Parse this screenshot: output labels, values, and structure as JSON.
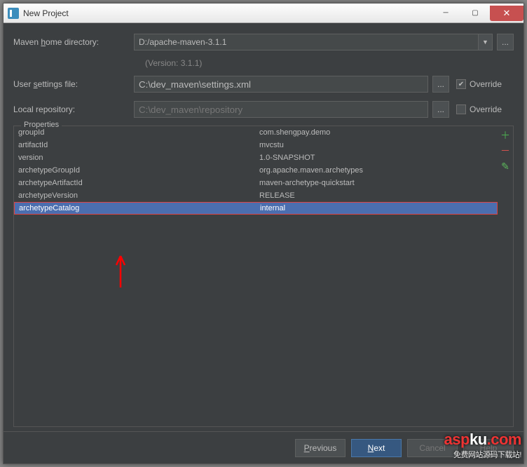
{
  "titlebar": {
    "title": "New Project"
  },
  "form": {
    "maven_home_label": "Maven home directory:",
    "maven_home_value": "D:/apache-maven-3.1.1",
    "version_text": "(Version: 3.1.1)",
    "user_settings_label": "User settings file:",
    "user_settings_value": "C:\\dev_maven\\settings.xml",
    "local_repo_label": "Local repository:",
    "local_repo_value": "C:\\dev_maven\\repository",
    "override_label": "Override",
    "browse_label": "..."
  },
  "panel": {
    "legend": "Properties",
    "rows": [
      {
        "key": "groupId",
        "value": "com.shengpay.demo",
        "selected": false
      },
      {
        "key": "artifactId",
        "value": "mvcstu",
        "selected": false
      },
      {
        "key": "version",
        "value": "1.0-SNAPSHOT",
        "selected": false
      },
      {
        "key": "archetypeGroupId",
        "value": "org.apache.maven.archetypes",
        "selected": false
      },
      {
        "key": "archetypeArtifactId",
        "value": "maven-archetype-quickstart",
        "selected": false
      },
      {
        "key": "archetypeVersion",
        "value": "RELEASE",
        "selected": false
      },
      {
        "key": "archetypeCatalog",
        "value": "internal",
        "selected": true
      }
    ]
  },
  "footer": {
    "previous": "Previous",
    "next": "Next",
    "cancel": "Cancel",
    "help": "Help"
  },
  "watermark": {
    "brand_a": "asp",
    "brand_b": "ku",
    "brand_c": ".com",
    "sub": "免费网站源码下载站!"
  }
}
